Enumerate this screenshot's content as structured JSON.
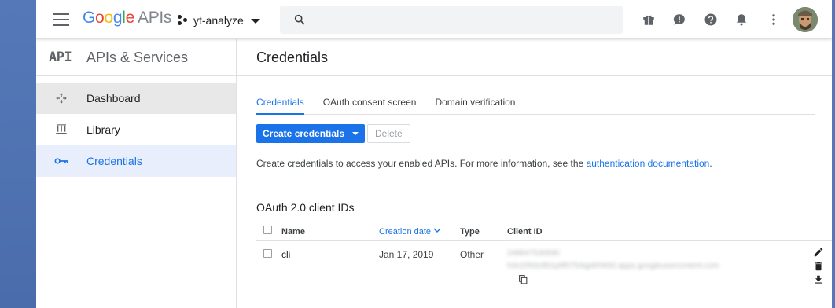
{
  "header": {
    "logo": {
      "google": [
        "G",
        "o",
        "o",
        "g",
        "l",
        "e"
      ],
      "suffix": "APIs"
    },
    "project_name": "yt-analyze",
    "search_placeholder": ""
  },
  "sidebar": {
    "logo_text": "API",
    "title": "APIs & Services",
    "items": [
      {
        "label": "Dashboard",
        "icon": "dashboard-icon"
      },
      {
        "label": "Library",
        "icon": "library-icon"
      },
      {
        "label": "Credentials",
        "icon": "key-icon"
      }
    ]
  },
  "main": {
    "title": "Credentials",
    "tabs": [
      {
        "label": "Credentials"
      },
      {
        "label": "OAuth consent screen"
      },
      {
        "label": "Domain verification"
      }
    ],
    "create_button": "Create credentials",
    "delete_button": "Delete",
    "info_text": "Create credentials to access your enabled APIs. For more information, see the ",
    "info_link": "authentication documentation",
    "info_end": ".",
    "section_title": "OAuth 2.0 client IDs",
    "table": {
      "headers": {
        "name": "Name",
        "created": "Creation date",
        "type": "Type",
        "client_id": "Client ID"
      },
      "rows": [
        {
          "name": "cli",
          "created": "Jan 17, 2019",
          "type": "Other",
          "client_id_line1": "248847530590",
          "client_id_line2": "h4n20h0c8b1p9f0754qp8rhk50.apps.googleusercontent.com"
        }
      ]
    }
  },
  "colors": {
    "accent": "#1a73e8",
    "active_nav_bg": "#e8eefb"
  }
}
